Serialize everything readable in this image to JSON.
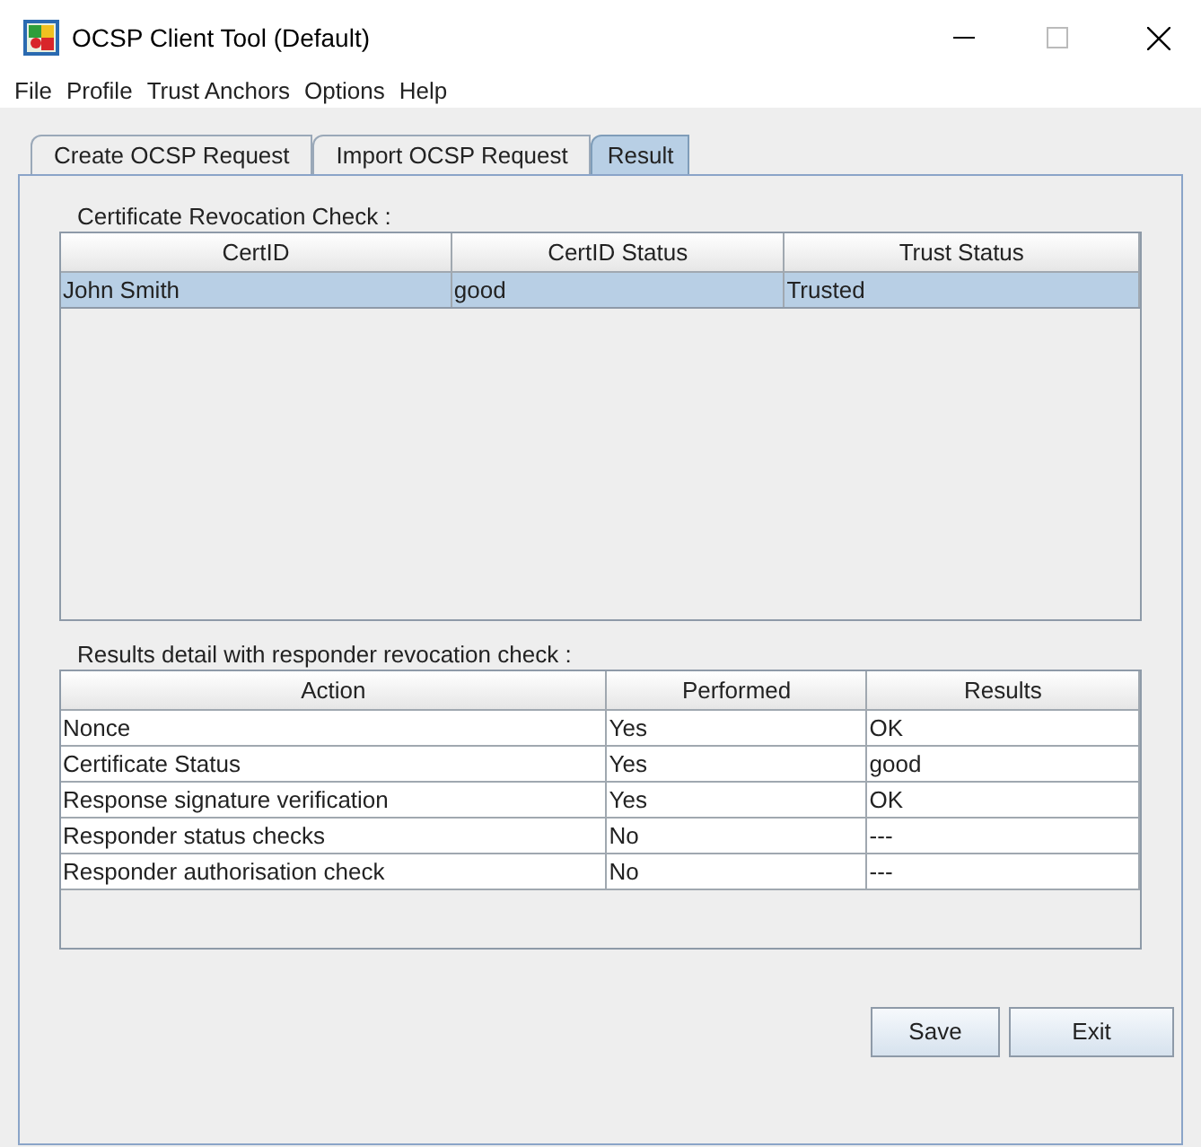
{
  "window": {
    "title": "OCSP Client Tool (Default)"
  },
  "menu": [
    "File",
    "Profile",
    "Trust Anchors",
    "Options",
    "Help"
  ],
  "tabs": [
    {
      "label": "Create OCSP Request",
      "selected": false
    },
    {
      "label": "Import OCSP Request",
      "selected": false
    },
    {
      "label": "Result",
      "selected": true
    }
  ],
  "revocation_check": {
    "label": "Certificate Revocation Check :",
    "columns": [
      "CertID",
      "CertID Status",
      "Trust Status"
    ],
    "rows": [
      {
        "cells": [
          "John Smith",
          "good",
          "Trusted"
        ],
        "selected": true
      }
    ]
  },
  "results_detail": {
    "label": "Results detail with responder revocation check :",
    "columns": [
      "Action",
      "Performed",
      "Results"
    ],
    "rows": [
      {
        "cells": [
          "Nonce",
          "Yes",
          "OK"
        ],
        "selected": false
      },
      {
        "cells": [
          "Certificate Status",
          "Yes",
          "good"
        ],
        "selected": false
      },
      {
        "cells": [
          "Response signature verification",
          "Yes",
          "OK"
        ],
        "selected": false
      },
      {
        "cells": [
          "Responder status checks",
          "No",
          "---"
        ],
        "selected": false
      },
      {
        "cells": [
          "Responder authorisation check",
          "No",
          "---"
        ],
        "selected": false
      }
    ]
  },
  "buttons": [
    "Save",
    "Exit"
  ]
}
